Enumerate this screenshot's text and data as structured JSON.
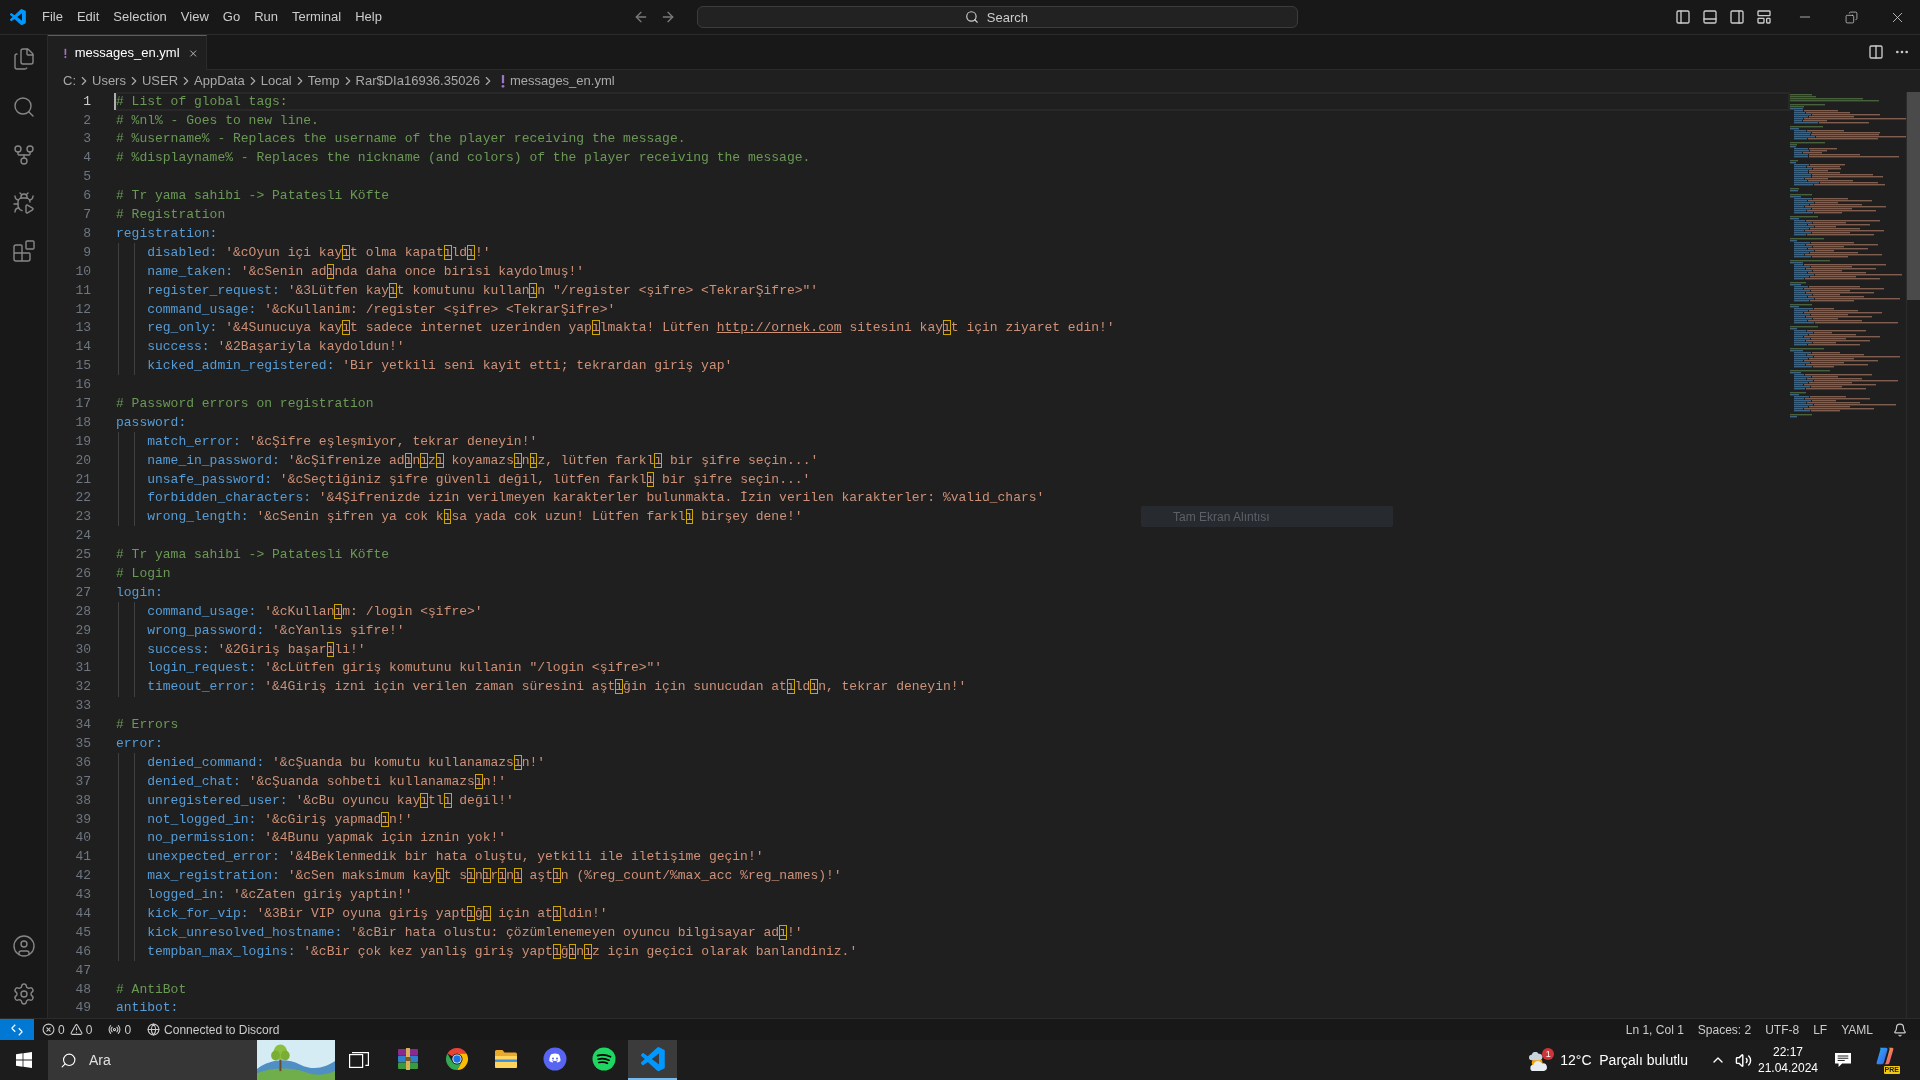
{
  "title_bar": {
    "menu": [
      "File",
      "Edit",
      "Selection",
      "View",
      "Go",
      "Run",
      "Terminal",
      "Help"
    ],
    "search": {
      "placeholder": "Search"
    }
  },
  "tabs": [
    {
      "label": "messages_en.yml",
      "selected": true
    }
  ],
  "breadcrumb": [
    {
      "label": "C:",
      "kind": "folder"
    },
    {
      "label": "Users",
      "kind": "folder"
    },
    {
      "label": "USER",
      "kind": "folder"
    },
    {
      "label": "AppData",
      "kind": "folder"
    },
    {
      "label": "Local",
      "kind": "folder"
    },
    {
      "label": "Temp",
      "kind": "folder"
    },
    {
      "label": "Rar$DIa16936.35026",
      "kind": "folder"
    },
    {
      "label": "messages_en.yml",
      "kind": "file"
    }
  ],
  "editor": {
    "unicode_highlight": true,
    "lines": [
      {
        "number": "1",
        "kind": "comment",
        "current": true,
        "text": "# List of global tags:"
      },
      {
        "number": "2",
        "kind": "comment",
        "current": false,
        "text": "# %nl% - Goes to new line."
      },
      {
        "number": "3",
        "kind": "comment",
        "current": false,
        "text": "# %username% - Replaces the username of the player receiving the message."
      },
      {
        "number": "4",
        "kind": "comment",
        "current": false,
        "text": "# %displayname% - Replaces the nickname (and colors) of the player receiving the message."
      },
      {
        "number": "5",
        "kind": "blank",
        "current": false
      },
      {
        "number": "6",
        "kind": "comment",
        "current": false,
        "text": "# Tr yama sahibi -> Patatesli Köfte"
      },
      {
        "number": "7",
        "kind": "comment",
        "current": false,
        "text": "# Registration"
      },
      {
        "number": "8",
        "kind": "mapping",
        "current": false,
        "key": "registration:",
        "children": [
          {
            "number": "9",
            "kind": "pair",
            "current": false,
            "key": "disabled:",
            "value": "'&cOyun içi kayıt olma kapatıldı!'"
          },
          {
            "number": "10",
            "kind": "pair",
            "current": false,
            "key": "name_taken:",
            "value": "'&cSenin adında daha once birisi kaydolmuş!'"
          },
          {
            "number": "11",
            "kind": "pair",
            "current": false,
            "key": "register_request:",
            "value": "'&3Lütfen kayıt komutunu kullanın \"/register <şifre> <TekrarŞifre>\"'"
          },
          {
            "number": "12",
            "kind": "pair",
            "current": false,
            "key": "command_usage:",
            "value": "'&cKullanim: /register <şifre> <TekrarŞifre>'"
          },
          {
            "number": "13",
            "kind": "pair",
            "current": false,
            "key": "reg_only:",
            "value_parts": [
              {
                "kind": "text",
                "text": "'&4Sunucuya kayıt sadece internet uzerinden yapılmakta! Lütfen "
              },
              {
                "kind": "link",
                "text": "http://ornek.com"
              },
              {
                "kind": "text",
                "text": " sitesini kayıt için ziyaret edin!'"
              }
            ]
          },
          {
            "number": "14",
            "kind": "pair",
            "current": false,
            "key": "success:",
            "value": "'&2Başariyla kaydoldun!'"
          },
          {
            "number": "15",
            "kind": "pair",
            "current": false,
            "key": "kicked_admin_registered:",
            "value": "'Bir yetkili seni kayit etti; tekrardan giriş yap'"
          }
        ]
      },
      {
        "number": "16",
        "kind": "blank",
        "current": false
      },
      {
        "number": "17",
        "kind": "comment",
        "current": false,
        "text": "# Password errors on registration"
      },
      {
        "number": "18",
        "kind": "mapping",
        "current": false,
        "key": "password:",
        "children": [
          {
            "number": "19",
            "kind": "pair",
            "current": false,
            "key": "match_error:",
            "value": "'&cŞifre eşleşmiyor, tekrar deneyin!'"
          },
          {
            "number": "20",
            "kind": "pair",
            "current": false,
            "key": "name_in_password:",
            "value": "'&cŞifrenize adınızı koyamazsınız, lütfen farklı bir şifre seçin...'"
          },
          {
            "number": "21",
            "kind": "pair",
            "current": false,
            "key": "unsafe_password:",
            "value": "'&cSeçtiğiniz şifre güvenli değil, lütfen farklı bir şifre seçin...'"
          },
          {
            "number": "22",
            "kind": "pair",
            "current": false,
            "key": "forbidden_characters:",
            "value": "'&4Şifrenizde izin verilmeyen karakterler bulunmakta. İzin verilen karakterler: %valid_chars'"
          },
          {
            "number": "23",
            "kind": "pair",
            "current": false,
            "key": "wrong_length:",
            "value": "'&cSenin şifren ya cok kısa yada cok uzun! Lütfen farklı birşey dene!'"
          }
        ]
      },
      {
        "number": "24",
        "kind": "blank",
        "current": false
      },
      {
        "number": "25",
        "kind": "comment",
        "current": false,
        "text": "# Tr yama sahibi -> Patatesli Köfte"
      },
      {
        "number": "26",
        "kind": "comment",
        "current": false,
        "text": "# Login"
      },
      {
        "number": "27",
        "kind": "mapping",
        "current": false,
        "key": "login:",
        "children": [
          {
            "number": "28",
            "kind": "pair",
            "current": false,
            "key": "command_usage:",
            "value": "'&cKullanım: /login <şifre>'"
          },
          {
            "number": "29",
            "kind": "pair",
            "current": false,
            "key": "wrong_password:",
            "value": "'&cYanlis şifre!'"
          },
          {
            "number": "30",
            "kind": "pair",
            "current": false,
            "key": "success:",
            "value": "'&2Giriş başarıli!'"
          },
          {
            "number": "31",
            "kind": "pair",
            "current": false,
            "key": "login_request:",
            "value": "'&cLütfen giriş komutunu kullanin \"/login <şifre>\"'"
          },
          {
            "number": "32",
            "kind": "pair",
            "current": false,
            "key": "timeout_error:",
            "value": "'&4Giriş izni için verilen zaman süresini aştığin için sunucudan atıldın, tekrar deneyin!'"
          }
        ]
      },
      {
        "number": "33",
        "kind": "blank",
        "current": false
      },
      {
        "number": "34",
        "kind": "comment",
        "current": false,
        "text": "# Errors"
      },
      {
        "number": "35",
        "kind": "mapping",
        "current": false,
        "key": "error:",
        "children": [
          {
            "number": "36",
            "kind": "pair",
            "current": false,
            "key": "denied_command:",
            "value": "'&cŞuanda bu komutu kullanamazsın!'"
          },
          {
            "number": "37",
            "kind": "pair",
            "current": false,
            "key": "denied_chat:",
            "value": "'&cŞuanda sohbeti kullanamazsın!'"
          },
          {
            "number": "38",
            "kind": "pair",
            "current": false,
            "key": "unregistered_user:",
            "value": "'&cBu oyuncu kayıtlı değil!'"
          },
          {
            "number": "39",
            "kind": "pair",
            "current": false,
            "key": "not_logged_in:",
            "value": "'&cGiriş yapmadın!'"
          },
          {
            "number": "40",
            "kind": "pair",
            "current": false,
            "key": "no_permission:",
            "value": "'&4Bunu yapmak için iznin yok!'"
          },
          {
            "number": "41",
            "kind": "pair",
            "current": false,
            "key": "unexpected_error:",
            "value": "'&4Beklenmedik bir hata oluştu, yetkili ile iletişime geçin!'"
          },
          {
            "number": "42",
            "kind": "pair",
            "current": false,
            "key": "max_registration:",
            "value": "'&cSen maksimum kayıt sınırını aştın (%reg_count/%max_acc %reg_names)!'"
          },
          {
            "number": "43",
            "kind": "pair",
            "current": false,
            "key": "logged_in:",
            "value": "'&cZaten giriş yaptin!'"
          },
          {
            "number": "44",
            "kind": "pair",
            "current": false,
            "key": "kick_for_vip:",
            "value": "'&3Bir VIP oyuna giriş yaptığı için atıldin!'"
          },
          {
            "number": "45",
            "kind": "pair",
            "current": false,
            "key": "kick_unresolved_hostname:",
            "value": "'&cBir hata olustu: çözümlenemeyen oyuncu bilgisayar adı!'"
          },
          {
            "number": "46",
            "kind": "pair",
            "current": false,
            "key": "tempban_max_logins:",
            "value": "'&cBir çok kez yanliş giriş yaptığınız için geçici olarak banlandiniz.'"
          }
        ]
      },
      {
        "number": "47",
        "kind": "blank",
        "current": false
      },
      {
        "number": "48",
        "kind": "comment",
        "current": false,
        "text": "# AntiBot"
      },
      {
        "number": "49",
        "kind": "mapping",
        "current": false,
        "key": "antibot:"
      }
    ]
  },
  "floating_label": "Tam Ekran Alıntısı",
  "status_bar": {
    "errors": "0",
    "warnings": "0",
    "ports": "0",
    "activity": "Connected to Discord",
    "items": [
      "Ln 1, Col 1",
      "Spaces: 2",
      "UTF-8",
      "LF",
      "YAML"
    ]
  },
  "taskbar": {
    "search": {
      "placeholder": "Ara"
    },
    "apps": [
      {
        "kind": "archive",
        "selected": false
      },
      {
        "kind": "browser",
        "selected": false
      },
      {
        "kind": "folder",
        "selected": false
      },
      {
        "kind": "chat",
        "selected": false
      },
      {
        "kind": "music",
        "selected": false
      },
      {
        "kind": "code",
        "selected": true
      }
    ],
    "weather_badge": "1",
    "weather": "12°C  Parçalı bulutlu",
    "time": "22:17",
    "date": "21.04.2024",
    "logo_tag": "PRE"
  }
}
